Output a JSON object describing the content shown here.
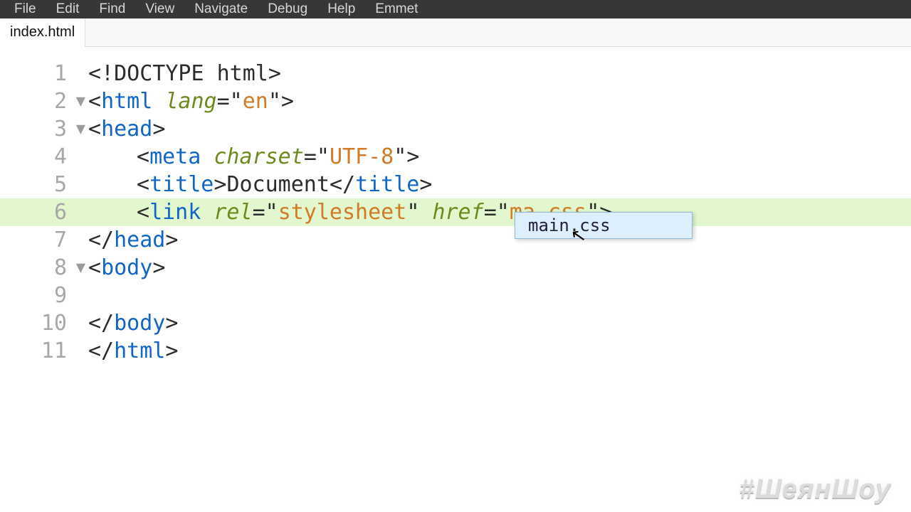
{
  "menubar": {
    "items": [
      "File",
      "Edit",
      "Find",
      "View",
      "Navigate",
      "Debug",
      "Help",
      "Emmet"
    ]
  },
  "tabs": {
    "items": [
      "index.html"
    ]
  },
  "gutter": {
    "lines": [
      "1",
      "2",
      "3",
      "4",
      "5",
      "6",
      "7",
      "8",
      "9",
      "10",
      "11"
    ]
  },
  "code": {
    "l1_doctype": "<!DOCTYPE html>",
    "l2": {
      "open": "<",
      "tag": "html",
      "sp": " ",
      "attr": "lang",
      "eq": "=\"",
      "val": "en",
      "close": "\">"
    },
    "l3": {
      "open": "<",
      "tag": "head",
      "close": ">"
    },
    "l4": {
      "open": "<",
      "tag": "meta",
      "sp": " ",
      "attr": "charset",
      "eq": "=\"",
      "val": "UTF-8",
      "close": "\">"
    },
    "l5": {
      "open1": "<",
      "tag1": "title",
      "gt1": ">",
      "text": "Document",
      "open2": "</",
      "tag2": "title",
      "gt2": ">"
    },
    "l6": {
      "open": "<",
      "tag": "link",
      "sp1": " ",
      "attr1": "rel",
      "eq1": "=\"",
      "val1": "stylesheet",
      "q1": "\"",
      "sp2": " ",
      "attr2": "href",
      "eq2": "=\"",
      "val2": "ma.css",
      "close": "\">"
    },
    "l7": {
      "open": "</",
      "tag": "head",
      "close": ">"
    },
    "l8": {
      "open": "<",
      "tag": "body",
      "close": ">"
    },
    "l9": "",
    "l10": {
      "open": "</",
      "tag": "body",
      "close": ">"
    },
    "l11": {
      "open": "</",
      "tag": "html",
      "close": ">"
    }
  },
  "autocomplete": {
    "items": [
      "main.css"
    ]
  },
  "watermark": "#ШеянШоу"
}
